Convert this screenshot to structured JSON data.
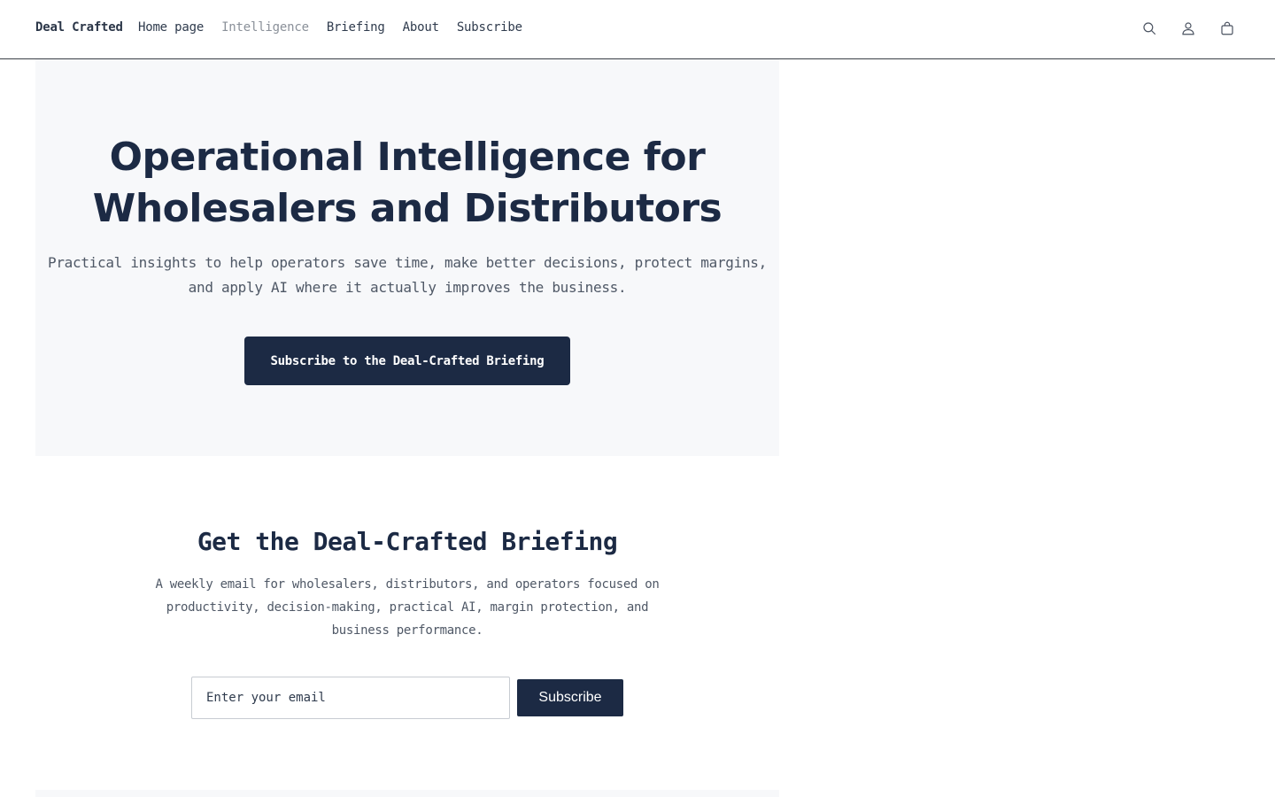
{
  "header": {
    "brand": "Deal Crafted",
    "nav": [
      {
        "label": "Home page",
        "active": false
      },
      {
        "label": "Intelligence",
        "active": true
      },
      {
        "label": "Briefing",
        "active": false
      },
      {
        "label": "About",
        "active": false
      },
      {
        "label": "Subscribe",
        "active": false
      }
    ],
    "icons": [
      "search-icon",
      "account-icon",
      "cart-icon"
    ]
  },
  "hero": {
    "title_line1": "Operational Intelligence for",
    "title_line2": "Wholesalers and Distributors",
    "subtitle_line1": "Practical insights to help operators save time, make better decisions, protect margins,",
    "subtitle_line2": "and apply AI where it actually improves the business.",
    "cta_label": "Subscribe to the Deal-Crafted Briefing"
  },
  "briefing": {
    "title": "Get the Deal-Crafted Briefing",
    "description_line1": "A weekly email for wholesalers, distributors, and operators focused on",
    "description_line2": "productivity, decision-making, practical AI, margin protection, and",
    "description_line3": "business performance.",
    "email_placeholder": "Enter your email",
    "subscribe_label": "Subscribe"
  },
  "colors": {
    "primary": "#1c2a44",
    "hero_background": "#f7f8fa",
    "nav_active": "#8a9099"
  }
}
